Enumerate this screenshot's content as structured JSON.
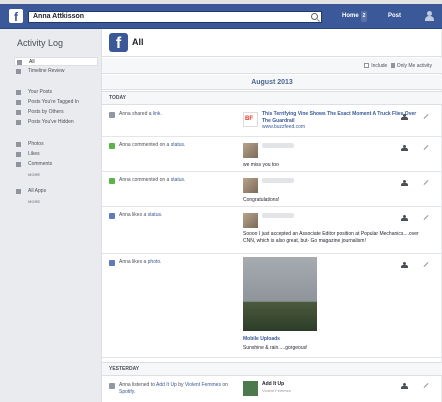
{
  "header": {
    "logo": "f",
    "search_value": "Anna Attkisson",
    "home_label": "Home",
    "home_badge": "2",
    "post_label": "Post"
  },
  "sidebar": {
    "title": "Activity Log",
    "items": [
      {
        "label": "All",
        "icon": "list-icon"
      },
      {
        "label": "Timeline Review",
        "icon": "timeline-icon"
      },
      {
        "label": "Your Posts",
        "icon": "person-icon"
      },
      {
        "label": "Posts You're Tagged In",
        "icon": "tag-icon"
      },
      {
        "label": "Posts by Others",
        "icon": "people-icon"
      },
      {
        "label": "Posts You've Hidden",
        "icon": "hidden-icon"
      },
      {
        "label": "Photos",
        "icon": "photo-icon"
      },
      {
        "label": "Likes",
        "icon": "like-icon"
      },
      {
        "label": "Comments",
        "icon": "comment-icon"
      },
      {
        "label": "All Apps",
        "icon": "apps-icon"
      }
    ],
    "more_label": "MORE"
  },
  "main": {
    "title": "All",
    "include_label": "Include",
    "only_me_label": "Only Me activity",
    "month": "August 2013",
    "sections": {
      "today": "TODAY",
      "yesterday": "YESTERDAY"
    },
    "entries": [
      {
        "actor": "Anna shared a ",
        "object": "link",
        "object_tail": ".",
        "link_title": "This Terrifying Vine Shows The Exact Moment A Truck Flies Over The Guardrail",
        "link_url": "www.buzzfeed.com"
      },
      {
        "actor": "Anna commented on a ",
        "object": "status",
        "object_tail": ".",
        "comment": "we miss you too"
      },
      {
        "actor": "Anna commented on a ",
        "object": "status",
        "object_tail": ".",
        "comment": "Congratulations!"
      },
      {
        "actor": "Anna likes a ",
        "object": "status",
        "object_tail": ".",
        "comment": "Soooo I just accepted an Associate Editor position at Popular Mechanics....over CNN, which is also great, but- Go magazine journalism!"
      },
      {
        "actor": "Anna likes a ",
        "object": "photo",
        "object_tail": ".",
        "photo_album": "Mobile Uploads",
        "photo_caption": "Sunshine & rain.....gorgeous!"
      },
      {
        "actor": "Anna listened to ",
        "object": "Add It Up",
        "mid": " by ",
        "artist": "Violent Femmes",
        "on": " on ",
        "app": "Spotify",
        "object_tail": ".",
        "song": "Add It Up",
        "song_artist": "Violent Femmes"
      }
    ]
  }
}
